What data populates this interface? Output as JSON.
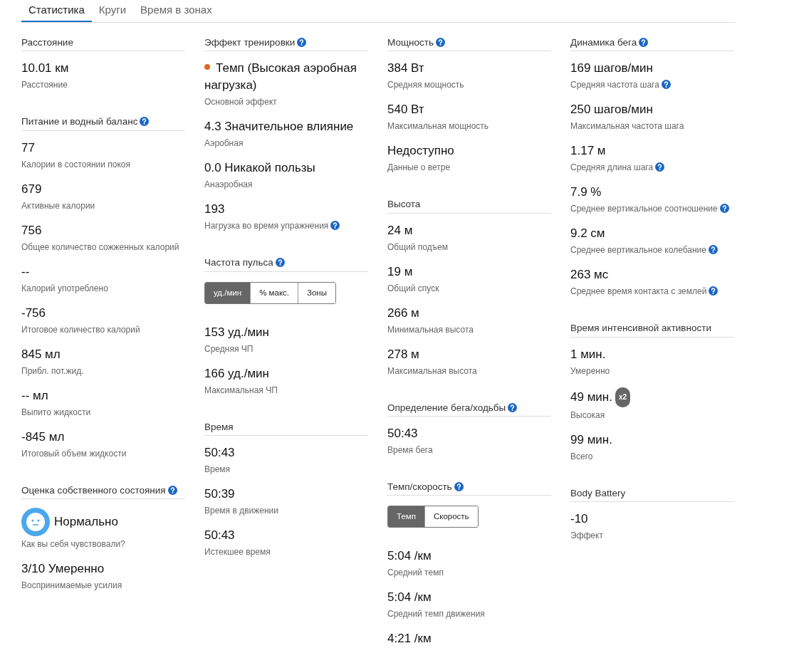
{
  "tabs": [
    {
      "label": "Статистика",
      "selected": true
    },
    {
      "label": "Круги",
      "selected": false
    },
    {
      "label": "Время в зонах",
      "selected": false
    }
  ],
  "columns": [
    [
      {
        "title": "Расстояние",
        "help": false,
        "stats": [
          {
            "value": "10.01 км",
            "label": "Расстояние"
          }
        ]
      },
      {
        "title": "Питание и водный баланс",
        "help": true,
        "stats": [
          {
            "value": "77",
            "label": "Калории в состоянии покоя"
          },
          {
            "value": "679",
            "label": "Активные калории"
          },
          {
            "value": "756",
            "label": "Общее количество сожженных калорий"
          },
          {
            "value": "--",
            "label": "Калорий употреблено"
          },
          {
            "value": "-756",
            "label": "Итоговое количество калорий"
          },
          {
            "value": "845 мл",
            "label": "Прибл. пот.жид."
          },
          {
            "value": "-- мл",
            "label": "Выпито жидкости"
          },
          {
            "value": "-845 мл",
            "label": "Итоговый объем жидкости"
          }
        ]
      },
      {
        "title": "Оценка собственного состояния",
        "help": true,
        "stats": [
          {
            "kind": "mood",
            "value": "Нормально",
            "label": "Как вы себя чувствовали?"
          },
          {
            "value": "3/10 Умеренно",
            "label": "Воспринимаемые усилия"
          }
        ]
      }
    ],
    [
      {
        "title": "Эффект тренировки",
        "help": true,
        "stats": [
          {
            "value": "Темп (Высокая аэробная нагрузка)",
            "label": "Основной эффект",
            "color": "#e0681c"
          },
          {
            "value": "4.3 Значительное влияние",
            "label": "Аэробная"
          },
          {
            "value": "0.0 Никакой пользы",
            "label": "Анаэробная"
          },
          {
            "value": "193",
            "label": "Нагрузка во время упражнения",
            "help": true
          }
        ]
      },
      {
        "title": "Частота пульса",
        "help": true,
        "toggle": [
          {
            "label": "уд./мин",
            "selected": true
          },
          {
            "label": "% макс.",
            "selected": false
          },
          {
            "label": "Зоны",
            "selected": false
          }
        ],
        "stats": [
          {
            "value": "153 уд./мин",
            "label": "Средняя ЧП"
          },
          {
            "value": "166 уд./мин",
            "label": "Максимальная ЧП"
          }
        ]
      },
      {
        "title": "Время",
        "help": false,
        "stats": [
          {
            "value": "50:43",
            "label": "Время"
          },
          {
            "value": "50:39",
            "label": "Время в движении"
          },
          {
            "value": "50:43",
            "label": "Истекшее время"
          }
        ]
      }
    ],
    [
      {
        "title": "Мощность",
        "help": true,
        "stats": [
          {
            "value": "384 Вт",
            "label": "Средняя мощность"
          },
          {
            "value": "540 Вт",
            "label": "Максимальная мощность"
          },
          {
            "value": "Недоступно",
            "label": "Данные о ветре"
          }
        ]
      },
      {
        "title": "Высота",
        "help": false,
        "stats": [
          {
            "value": "24 м",
            "label": "Общий подъем"
          },
          {
            "value": "19 м",
            "label": "Общий спуск"
          },
          {
            "value": "266 м",
            "label": "Минимальная высота"
          },
          {
            "value": "278 м",
            "label": "Максимальная высота"
          }
        ]
      },
      {
        "title": "Определение бега/ходьбы",
        "help": true,
        "stats": [
          {
            "value": "50:43",
            "label": "Время бега"
          }
        ]
      },
      {
        "title": "Темп/скорость",
        "help": true,
        "toggle": [
          {
            "label": "Темп",
            "selected": true
          },
          {
            "label": "Скорость",
            "selected": false
          }
        ],
        "stats": [
          {
            "value": "5:04 /км",
            "label": "Средний темп"
          },
          {
            "value": "5:04 /км",
            "label": "Средний темп движения"
          },
          {
            "value": "4:21 /км"
          }
        ]
      }
    ],
    [
      {
        "title": "Динамика бега",
        "help": true,
        "stats": [
          {
            "value": "169 шагов/мин",
            "label": "Средняя частота шага",
            "help": true
          },
          {
            "value": "250 шагов/мин",
            "label": "Максимальная частота шага"
          },
          {
            "value": "1.17 м",
            "label": "Средняя длина шага",
            "help": true
          },
          {
            "value": "7.9 %",
            "label": "Среднее вертикальное соотношение",
            "help": true
          },
          {
            "value": "9.2 см",
            "label": "Среднее вертикальное колебание",
            "help": true
          },
          {
            "value": "263 мс",
            "label": "Среднее время контакта с землей",
            "help": true
          }
        ]
      },
      {
        "title": "Время интенсивной активности",
        "help": false,
        "stats": [
          {
            "value": "1 мин.",
            "label": "Умеренно"
          },
          {
            "value": "49 мин.",
            "label": "Высокая",
            "badge": "x2"
          },
          {
            "value": "99 мин.",
            "label": "Всего"
          }
        ]
      },
      {
        "title": "Body Battery",
        "help": false,
        "stats": [
          {
            "value": "-10",
            "label": "Эффект"
          }
        ]
      }
    ]
  ]
}
